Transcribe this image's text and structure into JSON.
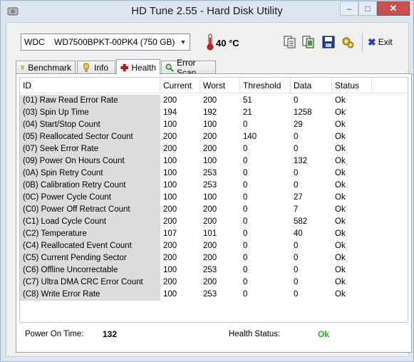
{
  "window": {
    "title": "HD Tune 2.55 - Hard Disk Utility",
    "controls": {
      "minimize": "–",
      "maximize": "□",
      "close": "✕"
    }
  },
  "toolbar": {
    "drive": "WDC    WD7500BPKT-00PK4 (750 GB)",
    "temperature": "40 °C",
    "exit_label": "Exit"
  },
  "tabs": [
    {
      "label": "Benchmark",
      "icon": "benchmark-icon"
    },
    {
      "label": "Info",
      "icon": "info-icon"
    },
    {
      "label": "Health",
      "icon": "health-cross-icon",
      "active": true
    },
    {
      "label": "Error Scan",
      "icon": "magnifier-icon"
    }
  ],
  "table": {
    "headers": [
      "ID",
      "Current",
      "Worst",
      "Threshold",
      "Data",
      "Status"
    ],
    "rows": [
      {
        "id": "(01) Raw Read Error Rate",
        "current": "200",
        "worst": "200",
        "threshold": "51",
        "data": "0",
        "status": "Ok"
      },
      {
        "id": "(03) Spin Up Time",
        "current": "194",
        "worst": "192",
        "threshold": "21",
        "data": "1258",
        "status": "Ok"
      },
      {
        "id": "(04) Start/Stop Count",
        "current": "100",
        "worst": "100",
        "threshold": "0",
        "data": "29",
        "status": "Ok"
      },
      {
        "id": "(05) Reallocated Sector Count",
        "current": "200",
        "worst": "200",
        "threshold": "140",
        "data": "0",
        "status": "Ok"
      },
      {
        "id": "(07) Seek Error Rate",
        "current": "200",
        "worst": "200",
        "threshold": "0",
        "data": "0",
        "status": "Ok"
      },
      {
        "id": "(09) Power On Hours Count",
        "current": "100",
        "worst": "100",
        "threshold": "0",
        "data": "132",
        "status": "Ok"
      },
      {
        "id": "(0A) Spin Retry Count",
        "current": "100",
        "worst": "253",
        "threshold": "0",
        "data": "0",
        "status": "Ok"
      },
      {
        "id": "(0B) Calibration Retry Count",
        "current": "100",
        "worst": "253",
        "threshold": "0",
        "data": "0",
        "status": "Ok"
      },
      {
        "id": "(0C) Power Cycle Count",
        "current": "100",
        "worst": "100",
        "threshold": "0",
        "data": "27",
        "status": "Ok"
      },
      {
        "id": "(C0) Power Off Retract Count",
        "current": "200",
        "worst": "200",
        "threshold": "0",
        "data": "7",
        "status": "Ok"
      },
      {
        "id": "(C1) Load Cycle Count",
        "current": "200",
        "worst": "200",
        "threshold": "0",
        "data": "582",
        "status": "Ok"
      },
      {
        "id": "(C2) Temperature",
        "current": "107",
        "worst": "101",
        "threshold": "0",
        "data": "40",
        "status": "Ok"
      },
      {
        "id": "(C4) Reallocated Event Count",
        "current": "200",
        "worst": "200",
        "threshold": "0",
        "data": "0",
        "status": "Ok"
      },
      {
        "id": "(C5) Current Pending Sector",
        "current": "200",
        "worst": "200",
        "threshold": "0",
        "data": "0",
        "status": "Ok"
      },
      {
        "id": "(C6) Offline Uncorrectable",
        "current": "100",
        "worst": "253",
        "threshold": "0",
        "data": "0",
        "status": "Ok"
      },
      {
        "id": "(C7) Ultra DMA CRC Error Count",
        "current": "200",
        "worst": "200",
        "threshold": "0",
        "data": "0",
        "status": "Ok"
      },
      {
        "id": "(C8) Write Error Rate",
        "current": "100",
        "worst": "253",
        "threshold": "0",
        "data": "0",
        "status": "Ok"
      }
    ]
  },
  "footer": {
    "power_on_label": "Power On Time:",
    "power_on_value": "132",
    "health_label": "Health Status:",
    "health_value": "Ok"
  },
  "colors": {
    "health_ok": "#22b022",
    "id_column_bg": "#dcdcdc",
    "close_button": "#c75050"
  }
}
